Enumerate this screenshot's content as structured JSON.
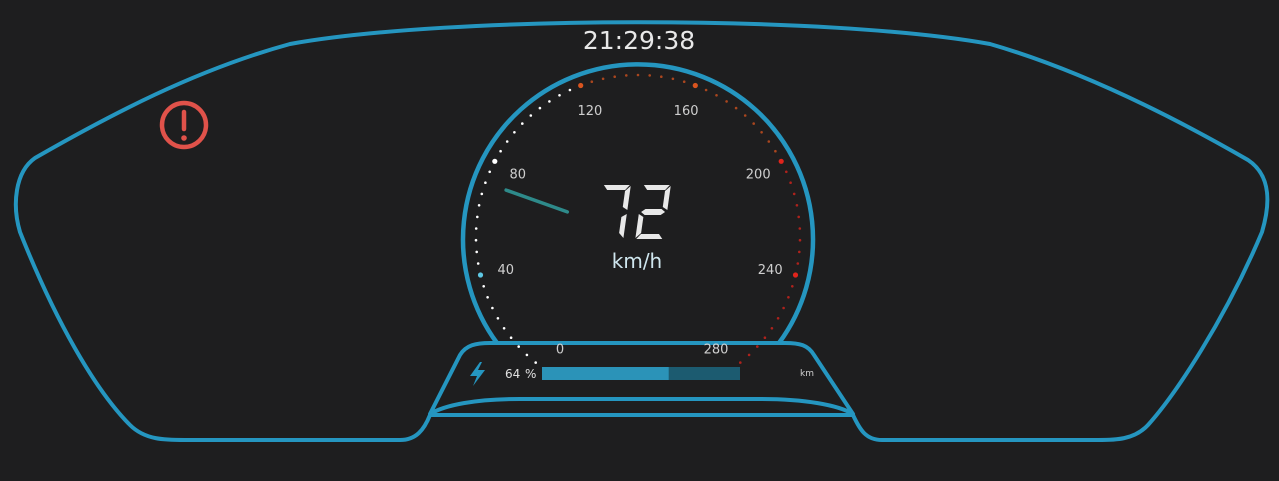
{
  "clock": {
    "time": "21:29:38"
  },
  "warning": {
    "icon": "exclamation-warning-icon",
    "color": "#e0524a"
  },
  "speedometer": {
    "speed": 72,
    "unit": "km/h",
    "min": 0,
    "max": 280,
    "ticks": [
      "0",
      "40",
      "80",
      "120",
      "160",
      "200",
      "240",
      "280"
    ],
    "colors": {
      "frame": "#2596c0",
      "cool": "#5ec8e4",
      "dots": "#ffffff",
      "warm": "#d9541f",
      "hot": "#e0241c",
      "needle": "#2e8a8a"
    }
  },
  "battery": {
    "icon": "lightning-bolt-icon",
    "percent_value": "64",
    "percent_sign": "%",
    "level": 0.64,
    "range_unit": "km",
    "colors": {
      "fill": "#2b93b8",
      "track": "#1c5b70"
    }
  }
}
